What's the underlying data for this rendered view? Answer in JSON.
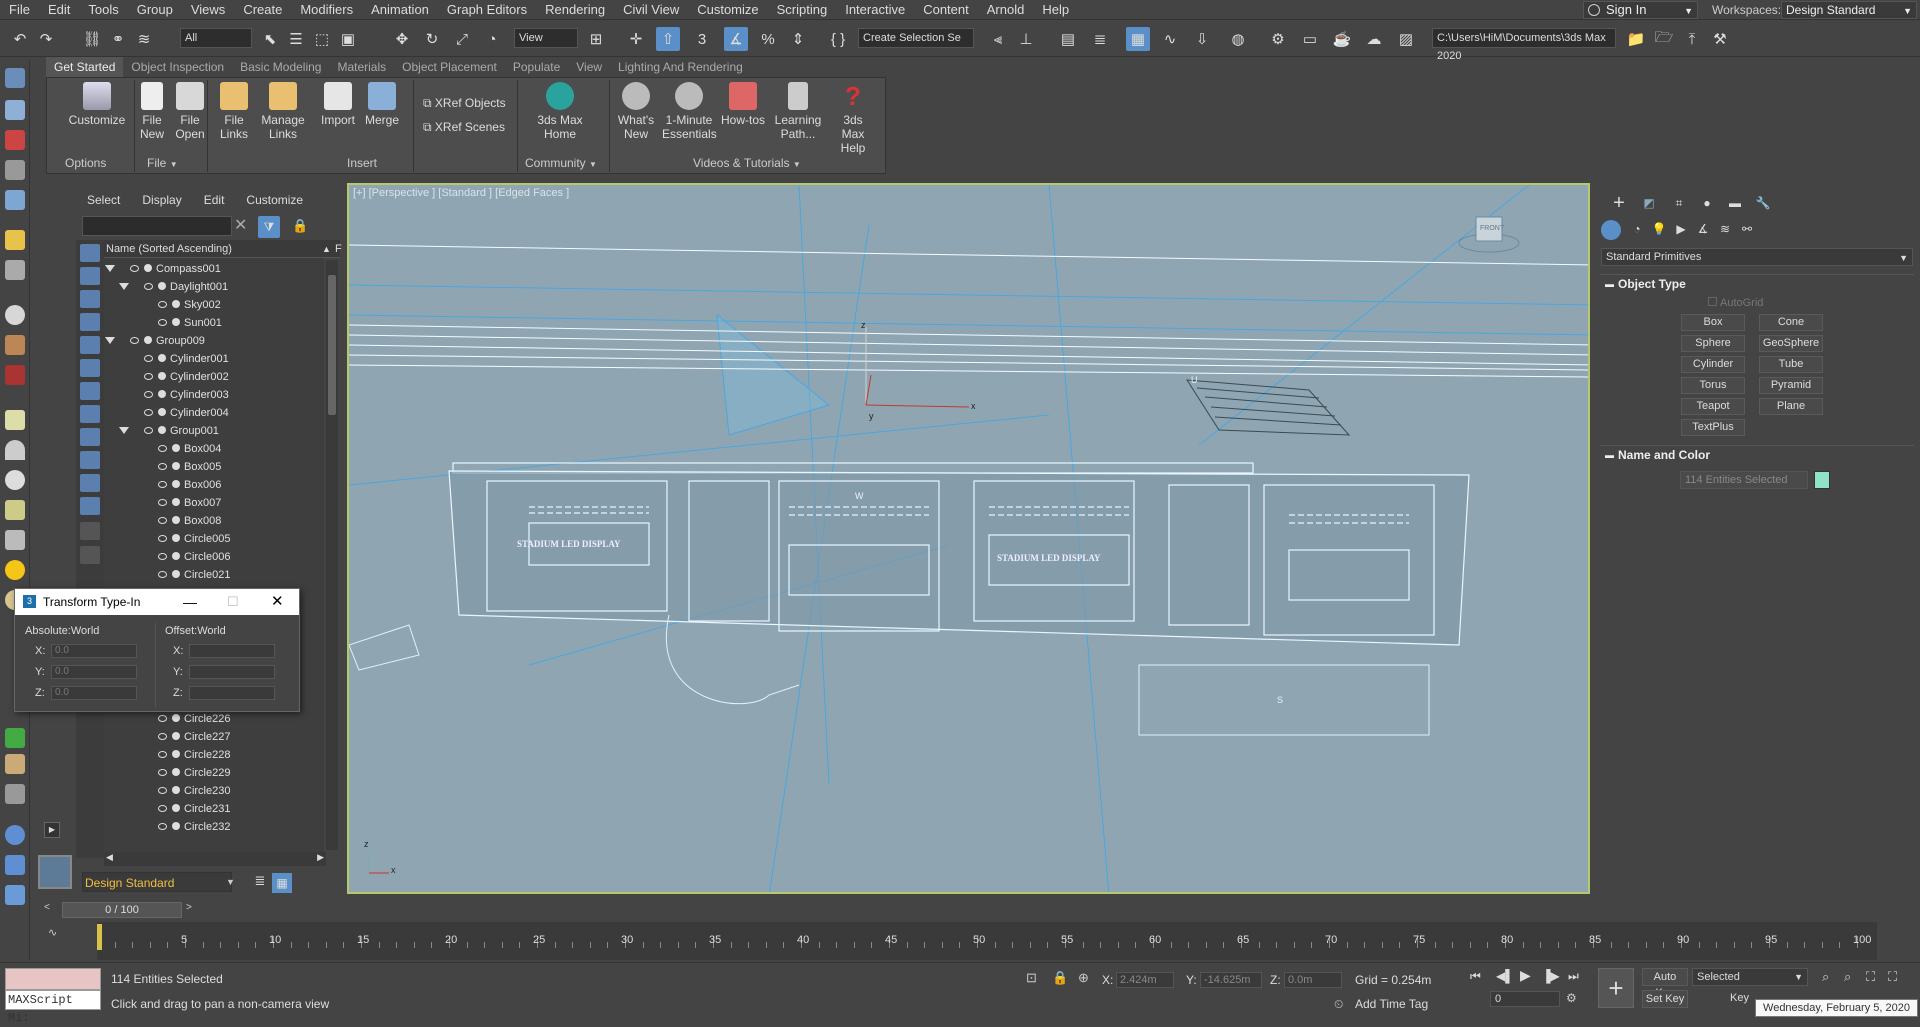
{
  "menu": [
    "File",
    "Edit",
    "Tools",
    "Group",
    "Views",
    "Create",
    "Modifiers",
    "Animation",
    "Graph Editors",
    "Rendering",
    "Civil View",
    "Customize",
    "Scripting",
    "Interactive",
    "Content",
    "Arnold",
    "Help"
  ],
  "account": {
    "signin": "Sign In",
    "workspaces_label": "Workspaces:",
    "workspace": "Design Standard"
  },
  "toolbar": {
    "filter": "All",
    "refcoord": "View",
    "selection_set": "Create Selection Se",
    "project_path": "C:\\Users\\HiM\\Documents\\3ds Max 2020"
  },
  "ribbon": {
    "tabs": [
      "Get Started",
      "Object Inspection",
      "Basic Modeling",
      "Materials",
      "Object Placement",
      "Populate",
      "View",
      "Lighting And Rendering"
    ],
    "buttons": {
      "customize": "Customize",
      "file_new": "File New",
      "file_open": "File Open",
      "file_links": "File Links",
      "manage_links": "Manage Links",
      "import": "Import",
      "merge": "Merge",
      "xref_objects": "XRef Objects",
      "xref_scenes": "XRef Scenes",
      "max_home": "3ds Max Home",
      "whats_new": "What's New",
      "one_minute": "1-Minute Essentials",
      "howtos": "How-tos",
      "learning_path": "Learning Path...",
      "max_help": "3ds Max Help"
    },
    "groups": {
      "options": "Options",
      "file": "File",
      "insert": "Insert",
      "community": "Community",
      "videos": "Videos & Tutorials"
    }
  },
  "scene_explorer": {
    "menu": [
      "Select",
      "Display",
      "Edit",
      "Customize"
    ],
    "column": "Name (Sorted Ascending)",
    "column2": "F",
    "rows": [
      {
        "name": "Compass001",
        "indent": 0,
        "expand": true,
        "vis": "eye"
      },
      {
        "name": "Daylight001",
        "indent": 1,
        "expand": true,
        "vis": "eye"
      },
      {
        "name": "Sky002",
        "indent": 2,
        "expand": false,
        "vis": "eye"
      },
      {
        "name": "Sun001",
        "indent": 2,
        "expand": false,
        "vis": "eye"
      },
      {
        "name": "Group009",
        "indent": 0,
        "expand": true,
        "vis": "eye"
      },
      {
        "name": "Cylinder001",
        "indent": 1,
        "expand": false,
        "vis": "eye"
      },
      {
        "name": "Cylinder002",
        "indent": 1,
        "expand": false,
        "vis": "eye"
      },
      {
        "name": "Cylinder003",
        "indent": 1,
        "expand": false,
        "vis": "eye"
      },
      {
        "name": "Cylinder004",
        "indent": 1,
        "expand": false,
        "vis": "eye"
      },
      {
        "name": "Group001",
        "indent": 1,
        "expand": true,
        "vis": "eye"
      },
      {
        "name": "Box004",
        "indent": 2,
        "expand": false,
        "vis": "eye"
      },
      {
        "name": "Box005",
        "indent": 2,
        "expand": false,
        "vis": "eye"
      },
      {
        "name": "Box006",
        "indent": 2,
        "expand": false,
        "vis": "eye"
      },
      {
        "name": "Box007",
        "indent": 2,
        "expand": false,
        "vis": "eye"
      },
      {
        "name": "Box008",
        "indent": 2,
        "expand": false,
        "vis": "eye"
      },
      {
        "name": "Circle005",
        "indent": 2,
        "expand": false,
        "vis": "eye"
      },
      {
        "name": "Circle006",
        "indent": 2,
        "expand": false,
        "vis": "eye"
      },
      {
        "name": "Circle021",
        "indent": 2,
        "expand": false,
        "vis": "eye"
      },
      {
        "name": "",
        "indent": 2,
        "expand": false,
        "vis": "none"
      },
      {
        "name": "",
        "indent": 2,
        "expand": false,
        "vis": "none"
      },
      {
        "name": "",
        "indent": 2,
        "expand": false,
        "vis": "none"
      },
      {
        "name": "",
        "indent": 2,
        "expand": false,
        "vis": "none"
      },
      {
        "name": "",
        "indent": 2,
        "expand": false,
        "vis": "none"
      },
      {
        "name": "",
        "indent": 2,
        "expand": false,
        "vis": "none"
      },
      {
        "name": "Circle225",
        "indent": 2,
        "expand": false,
        "vis": "eye"
      },
      {
        "name": "Circle226",
        "indent": 2,
        "expand": false,
        "vis": "eye"
      },
      {
        "name": "Circle227",
        "indent": 2,
        "expand": false,
        "vis": "eye"
      },
      {
        "name": "Circle228",
        "indent": 2,
        "expand": false,
        "vis": "eye"
      },
      {
        "name": "Circle229",
        "indent": 2,
        "expand": false,
        "vis": "eye"
      },
      {
        "name": "Circle230",
        "indent": 2,
        "expand": false,
        "vis": "eye"
      },
      {
        "name": "Circle231",
        "indent": 2,
        "expand": false,
        "vis": "eye"
      },
      {
        "name": "Circle232",
        "indent": 2,
        "expand": false,
        "vis": "eye"
      }
    ],
    "workspace": "Design Standard"
  },
  "transform_typein": {
    "title": "Transform Type-In",
    "absolute": "Absolute:World",
    "offset": "Offset:World",
    "axes": [
      "X:",
      "Y:",
      "Z:"
    ],
    "abs_values": [
      "0.0",
      "0.0",
      "0.0"
    ]
  },
  "viewport": {
    "label": "[+] [Perspective ] [Standard ] [Edged Faces ]",
    "sign_text_1": "STADIUM LED DISPLAY",
    "sign_text_2": "STADIUM LED DISPLAY",
    "viewcube_label": "FRONT",
    "axis_z": "z",
    "axis_y": "y",
    "axis_x": "x",
    "label_w": "W",
    "label_u": "U",
    "label_s": "S"
  },
  "command_panel": {
    "category": "Standard Primitives",
    "object_type": "Object Type",
    "autogrid": "AutoGrid",
    "primitives": [
      "Box",
      "Cone",
      "Sphere",
      "GeoSphere",
      "Cylinder",
      "Tube",
      "Torus",
      "Pyramid",
      "Teapot",
      "Plane",
      "TextPlus"
    ],
    "name_and_color": "Name and Color",
    "name_value": "114 Entities Selected",
    "swatch_color": "#8fe3c8"
  },
  "timeline": {
    "frame": "0 / 100",
    "ticks": [
      "5",
      "10",
      "15",
      "20",
      "25",
      "30",
      "35",
      "40",
      "45",
      "50",
      "55",
      "60",
      "65",
      "70",
      "75",
      "80",
      "85",
      "90",
      "95",
      "100"
    ]
  },
  "status": {
    "maxscript": "MAXScript Mi:",
    "selection": "114 Entities Selected",
    "prompt": "Click and drag to pan a non-camera view",
    "x_label": "X:",
    "x": "2.424m",
    "y_label": "Y:",
    "y": "-14.625m",
    "z_label": "Z:",
    "z": "0.0m",
    "grid": "Grid = 0.254m",
    "add_time_tag": "Add Time Tag",
    "auto_key": "Auto Key",
    "key_mode": "Selected",
    "set_key": "Set Key",
    "key_filters": "Key",
    "frame_field": "0",
    "date": "Wednesday, February 5, 2020"
  }
}
